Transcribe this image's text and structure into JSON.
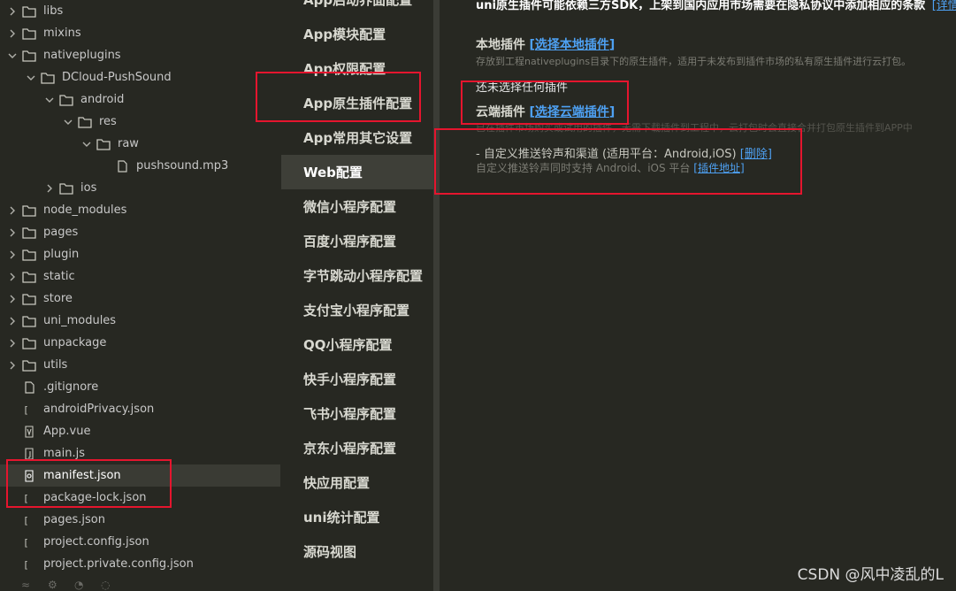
{
  "file_tree": {
    "items": [
      {
        "label": "libs",
        "type": "folder",
        "depth": 0,
        "expanded": false
      },
      {
        "label": "mixins",
        "type": "folder",
        "depth": 0,
        "expanded": false
      },
      {
        "label": "nativeplugins",
        "type": "folder",
        "depth": 0,
        "expanded": true
      },
      {
        "label": "DCloud-PushSound",
        "type": "folder",
        "depth": 1,
        "expanded": true
      },
      {
        "label": "android",
        "type": "folder",
        "depth": 2,
        "expanded": true
      },
      {
        "label": "res",
        "type": "folder",
        "depth": 3,
        "expanded": true
      },
      {
        "label": "raw",
        "type": "folder",
        "depth": 4,
        "expanded": true
      },
      {
        "label": "pushsound.mp3",
        "type": "file",
        "depth": 5
      },
      {
        "label": "ios",
        "type": "folder",
        "depth": 2,
        "expanded": false
      },
      {
        "label": "node_modules",
        "type": "folder",
        "depth": 0,
        "expanded": false
      },
      {
        "label": "pages",
        "type": "folder",
        "depth": 0,
        "expanded": false
      },
      {
        "label": "plugin",
        "type": "folder",
        "depth": 0,
        "expanded": false
      },
      {
        "label": "static",
        "type": "folder",
        "depth": 0,
        "expanded": false
      },
      {
        "label": "store",
        "type": "folder",
        "depth": 0,
        "expanded": false
      },
      {
        "label": "uni_modules",
        "type": "folder",
        "depth": 0,
        "expanded": false
      },
      {
        "label": "unpackage",
        "type": "folder",
        "depth": 0,
        "expanded": false
      },
      {
        "label": "utils",
        "type": "folder",
        "depth": 0,
        "expanded": false
      },
      {
        "label": ".gitignore",
        "type": "file",
        "depth": 0
      },
      {
        "label": "androidPrivacy.json",
        "type": "json",
        "depth": 0
      },
      {
        "label": "App.vue",
        "type": "vue",
        "depth": 0
      },
      {
        "label": "main.js",
        "type": "js",
        "depth": 0
      },
      {
        "label": "manifest.json",
        "type": "manifest",
        "depth": 0,
        "selected": true
      },
      {
        "label": "package-lock.json",
        "type": "json",
        "depth": 0
      },
      {
        "label": "pages.json",
        "type": "json",
        "depth": 0
      },
      {
        "label": "project.config.json",
        "type": "json",
        "depth": 0
      },
      {
        "label": "project.private.config.json",
        "type": "json",
        "depth": 0
      }
    ]
  },
  "config_nav": {
    "items": [
      {
        "label": "App启动界面配置"
      },
      {
        "label": "App模块配置"
      },
      {
        "label": "App权限配置"
      },
      {
        "label": "App原生插件配置"
      },
      {
        "label": "App常用其它设置"
      },
      {
        "label": "Web配置",
        "active": true
      },
      {
        "label": "微信小程序配置"
      },
      {
        "label": "百度小程序配置"
      },
      {
        "label": "字节跳动小程序配置"
      },
      {
        "label": "支付宝小程序配置"
      },
      {
        "label": "QQ小程序配置"
      },
      {
        "label": "快手小程序配置"
      },
      {
        "label": "飞书小程序配置"
      },
      {
        "label": "京东小程序配置"
      },
      {
        "label": "快应用配置"
      },
      {
        "label": "uni统计配置"
      },
      {
        "label": "源码视图"
      }
    ]
  },
  "content": {
    "notice_text": "uni原生插件可能依赖三方SDK，上架到国内应用市场需要在隐私协议中添加相应的条款",
    "notice_link": "[详情]",
    "local_title": "本地插件",
    "local_link": "选择本地插件",
    "local_desc": "存放到工程nativeplugins目录下的原生插件，适用于未发布到插件市场的私有原生插件进行云打包。",
    "local_none": "还未选择任何插件",
    "cloud_title": "云端插件",
    "cloud_link": "选择云端插件",
    "cloud_desc": "已在插件市场购买或试用的插件，无需下载插件到工程中，云打包时会直接合并打包原生插件到APP中",
    "plugin_name": "- 自定义推送铃声和渠道 (适用平台：Android,iOS)",
    "plugin_delete": "删除",
    "plugin_desc": "自定义推送铃声同时支持 Android、iOS 平台",
    "plugin_link": "插件地址"
  },
  "watermark": "CSDN @风中凌乱的L",
  "colors": {
    "annotation": "#e5152e",
    "link": "#4ea1f3",
    "background": "#272822"
  }
}
